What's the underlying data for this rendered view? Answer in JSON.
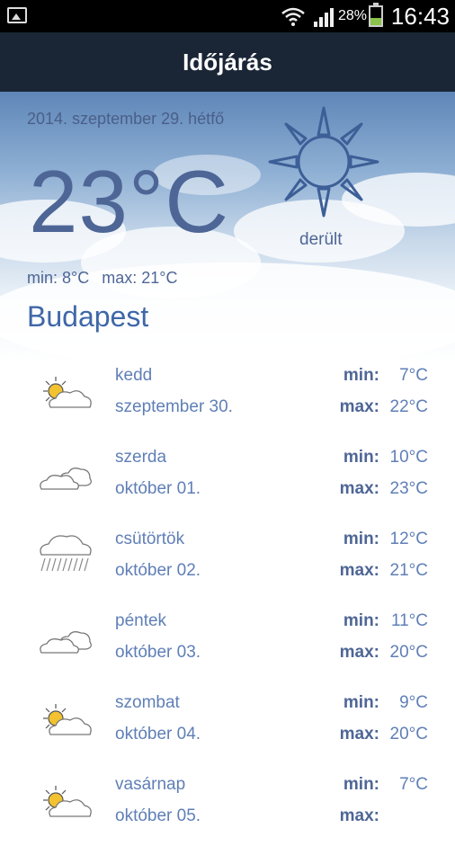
{
  "status_bar": {
    "battery_percent": "28%",
    "time": "16:43",
    "icons": [
      "gallery-notification-icon",
      "wifi-icon",
      "signal-icon",
      "battery-icon"
    ]
  },
  "app_bar": {
    "title": "Időjárás"
  },
  "current": {
    "date": "2014. szeptember 29. hétfő",
    "temperature": "23°C",
    "condition": "derült",
    "condition_icon": "sun-icon",
    "min": "min: 8°C",
    "max": "max: 21°C",
    "city": "Budapest"
  },
  "labels": {
    "min": "min:",
    "max": "max:"
  },
  "forecast": [
    {
      "day": "kedd",
      "date": "szeptember 30.",
      "min": "7°C",
      "max": "22°C",
      "icon": "partly-sunny-icon"
    },
    {
      "day": "szerda",
      "date": "október 01.",
      "min": "10°C",
      "max": "23°C",
      "icon": "cloudy-icon"
    },
    {
      "day": "csütörtök",
      "date": "október 02.",
      "min": "12°C",
      "max": "21°C",
      "icon": "rain-icon"
    },
    {
      "day": "péntek",
      "date": "október 03.",
      "min": "11°C",
      "max": "20°C",
      "icon": "cloudy-icon"
    },
    {
      "day": "szombat",
      "date": "október 04.",
      "min": "9°C",
      "max": "20°C",
      "icon": "partly-sunny-icon"
    },
    {
      "day": "vasárnap",
      "date": "október 05.",
      "min": "7°C",
      "max": "",
      "icon": "partly-sunny-icon"
    }
  ],
  "colors": {
    "app_bar": "#1a2636",
    "accent": "#3f67a8",
    "text": "#5f7fb6"
  }
}
